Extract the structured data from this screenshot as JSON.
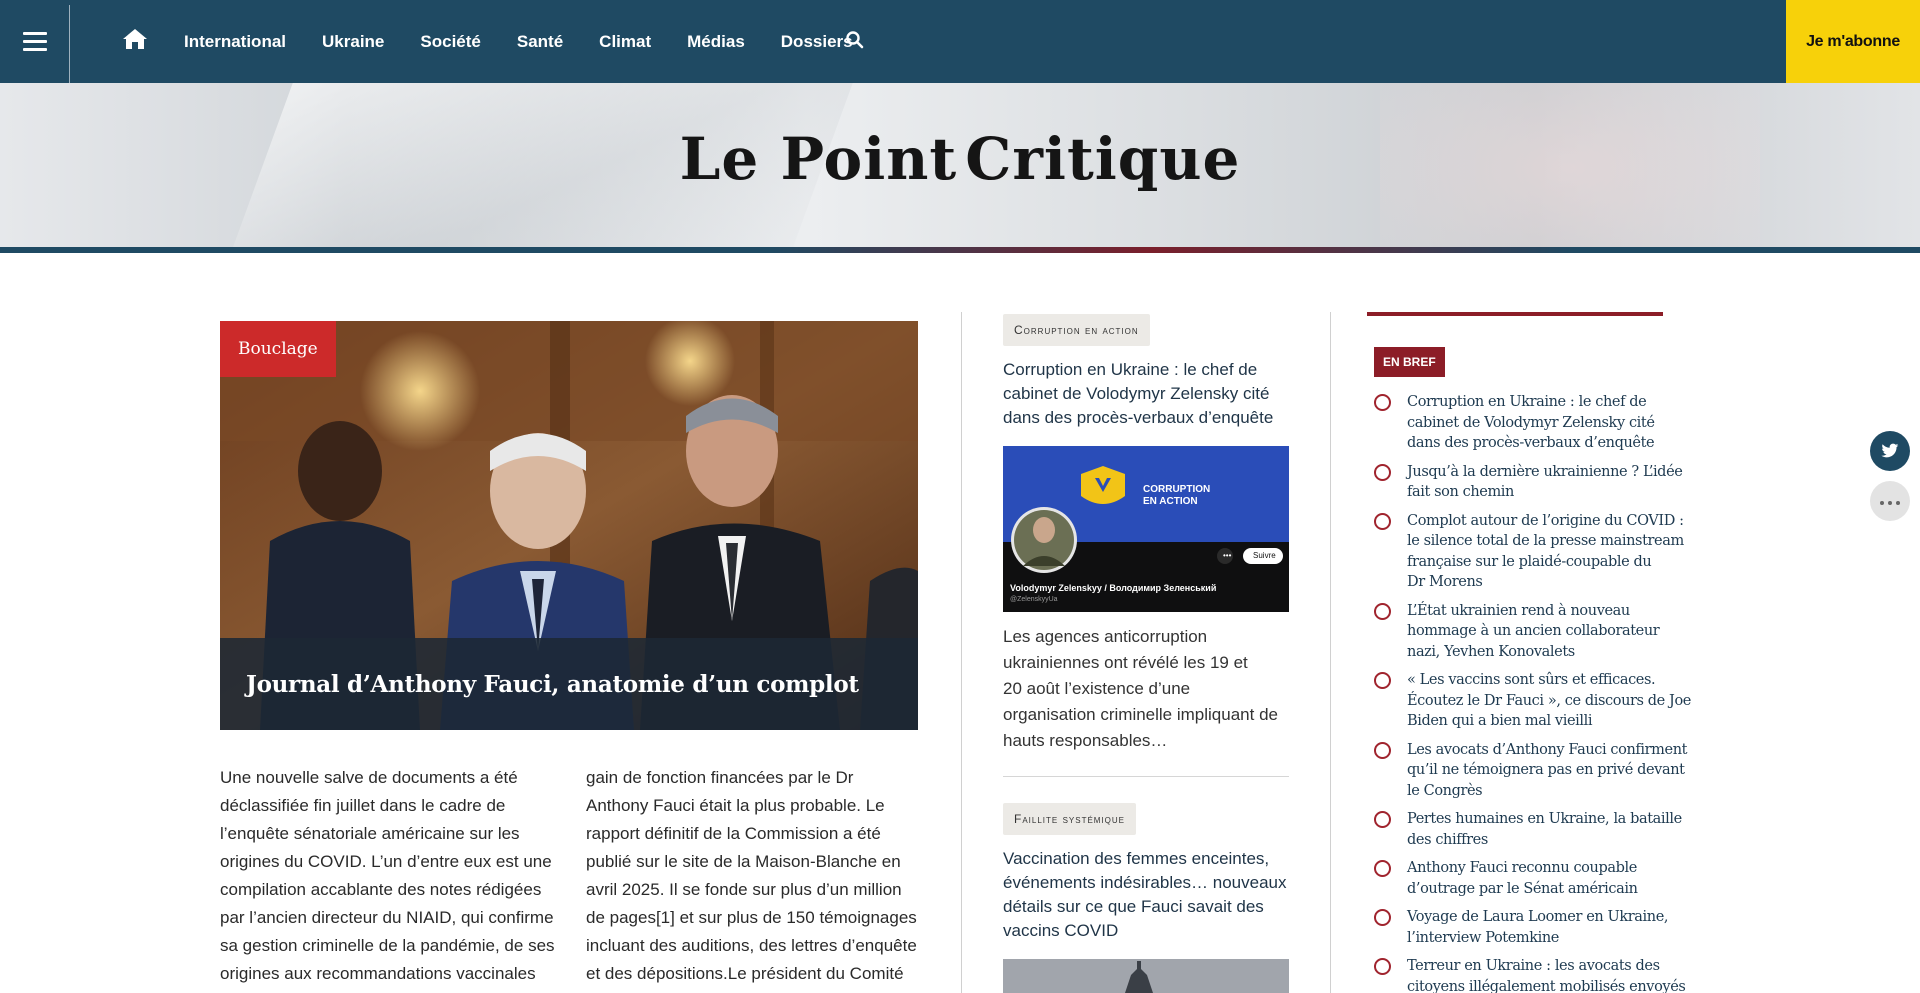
{
  "nav": {
    "items": [
      "International",
      "Ukraine",
      "Société",
      "Santé",
      "Climat",
      "Médias",
      "Dossiers"
    ],
    "subscribe_label": "Je m'abonne"
  },
  "masthead": {
    "logo_left": "Le Point",
    "logo_right": "Critique"
  },
  "feature": {
    "badge": "Bouclage",
    "title": "Journal d’Anthony Fauci, anatomie d’un complot",
    "col1": [
      "Une nouvelle salve de documents a été",
      "déclassifiée fin juillet dans le cadre de",
      "l’enquête sénatoriale américaine sur les",
      "origines du COVID. L’un d’entre eux est une",
      "compilation accablante des notes rédigées",
      "par l’ancien directeur du NIAID, qui confirme",
      "sa gestion criminelle de la pandémie, de ses",
      "origines aux recommandations vaccinales"
    ],
    "col2": [
      "gain de fonction financées par le Dr",
      "Anthony Fauci était la plus probable. Le",
      "rapport définitif de la Commission a été",
      "publié sur le site de la Maison-Blanche en",
      "avril 2025. Il se fonde sur plus d’un million",
      "de pages[1] et sur plus de 150 témoignages",
      "incluant des auditions, des lettres d’enquête",
      "et des dépositions.Le président du Comité"
    ]
  },
  "mid": {
    "article1": {
      "tag": "Corruption en action",
      "title_lines": [
        "Corruption en Ukraine : le chef de",
        "cabinet de Volodymyr Zelensky cité",
        "dans des procès-verbaux d’enquête"
      ],
      "thumb_banner": [
        "CORRUPTION",
        "EN ACTION"
      ],
      "thumb_name": "Volodymyr Zelenskyy / Володимир Зеленський",
      "thumb_handle": "@ZelenskyyUa",
      "thumb_follow": "Suivre",
      "excerpt_lines": [
        "Les agences anticorruption",
        "ukrainiennes ont révélé les 19 et",
        "20 août l’existence d’une",
        "organisation criminelle impliquant de",
        "hauts responsables…"
      ]
    },
    "article2": {
      "tag": "Faillite systémique",
      "title_lines": [
        "Vaccination des femmes enceintes,",
        "événements indésirables… nouveaux",
        "détails sur ce que Fauci savait des",
        "vaccins COVID"
      ]
    }
  },
  "bref": {
    "label": "EN BREF",
    "items": [
      [
        "Corruption en Ukraine : le chef de",
        "cabinet de Volodymyr Zelensky cité",
        "dans des procès-verbaux d’enquête"
      ],
      [
        "Jusqu’à la dernière ukrainienne ? L’idée",
        "fait son chemin"
      ],
      [
        "Complot autour de l’origine du COVID :",
        "le silence total de la presse mainstream",
        "française sur le plaidé-coupable du",
        "Dr Morens"
      ],
      [
        "L’État ukrainien rend à nouveau",
        "hommage à un ancien collaborateur",
        "nazi, Yevhen Konovalets"
      ],
      [
        "« Les vaccins sont sûrs et efficaces.",
        "Écoutez le Dr Fauci », ce discours de Joe",
        "Biden qui a bien mal vieilli"
      ],
      [
        "Les avocats d’Anthony Fauci confirment",
        "qu’il ne témoignera pas en privé devant",
        "le Congrès"
      ],
      [
        "Pertes humaines en Ukraine, la bataille",
        "des chiffres"
      ],
      [
        "Anthony Fauci reconnu coupable",
        "d’outrage par le Sénat américain"
      ],
      [
        "Voyage de Laura Loomer en Ukraine,",
        "l’interview Potemkine"
      ],
      [
        "Terreur en Ukraine : les avocats des",
        "citoyens illégalement mobilisés envoyés"
      ]
    ]
  },
  "icons": {
    "menu": "hamburger-icon",
    "home": "home-icon",
    "search": "search-icon",
    "twitter": "twitter-icon",
    "more": "more-icon"
  },
  "colors": {
    "nav_bg": "#1f4a63",
    "subscribe_bg": "#f7d10a",
    "badge_red": "#cc2a2a",
    "bref_red": "#8c1d27"
  }
}
